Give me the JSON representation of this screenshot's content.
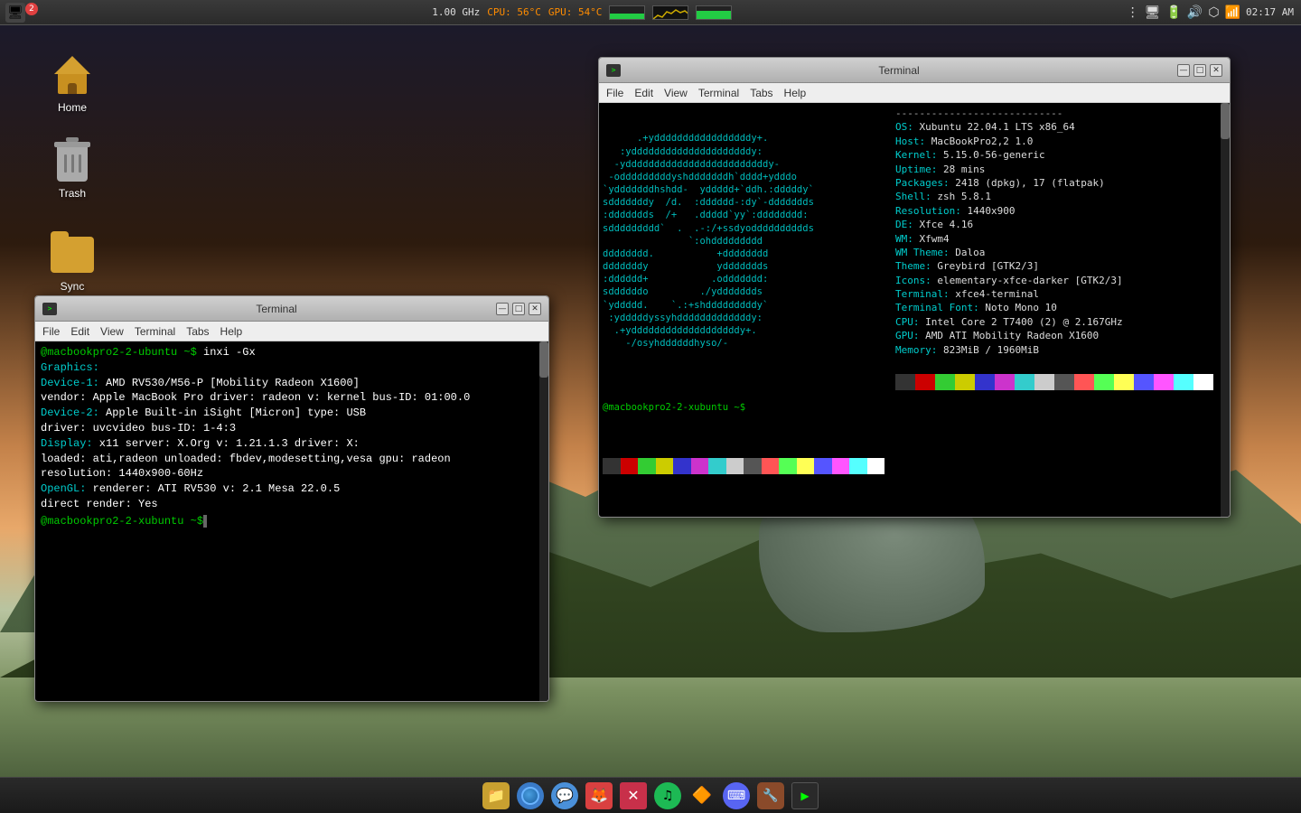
{
  "desktop": {
    "icons": [
      {
        "id": "home",
        "label": "Home",
        "type": "home"
      },
      {
        "id": "trash",
        "label": "Trash",
        "type": "trash"
      },
      {
        "id": "sync",
        "label": "Sync",
        "type": "folder"
      }
    ]
  },
  "top_panel": {
    "app_badge": "2",
    "cpu_label": "1.00 GHz",
    "cpu_temp": "CPU: 56°C",
    "gpu_temp": "GPU: 54°C",
    "time": "02:17 AM"
  },
  "terminal_big": {
    "title": "Terminal",
    "menu_items": [
      "File",
      "Edit",
      "View",
      "Terminal",
      "Tabs",
      "Help"
    ],
    "left_content": [
      "      .+ydddddddddddddddddy+.",
      "   :ydddddddddddddddddddddy:",
      "  -ydddddddddddddddddddddddddy-",
      " -odddddddddyshdddddddh`dddd+ydddo",
      "`ydddddddhshdd-  yddddd+`ddh.:dddddy`",
      "sdddddddy  /d.  :dddddd-:dy`-ddddddds",
      ":ddddddds  /+   .ddddd`yy`:dddddddd:",
      "sddddddddd`  .  .-:/+ssdyodddddddddds",
      "                  `:ohddddddddd",
      "dddddddd.           +dddddddd",
      "dddddddy            yddddddds",
      ":dddddd+           .oddddddd:",
      "sddddddo         ./yddddddds",
      "`yddddd.    `.:+shdddddddddy`",
      " :ydddddyssyhdddddddddddddy:",
      "  .+ydddddddddddddddddddy+.",
      "    -/osyhddddddhyso/-"
    ],
    "right_content": {
      "os": "OS: Xubuntu 22.04.1 LTS x86_64",
      "host": "Host: MacBookPro2,2 1.0",
      "kernel": "Kernel: 5.15.0-56-generic",
      "uptime": "Uptime: 28 mins",
      "packages": "Packages: 2418 (dpkg), 17 (flatpak)",
      "shell": "Shell: zsh 5.8.1",
      "resolution": "Resolution: 1440x900",
      "de": "DE: Xfce 4.16",
      "wm": "WM: Xfwm4",
      "wm_theme": "WM Theme: Daloa",
      "theme": "Theme: Greybird [GTK2/3]",
      "icons": "Icons: elementary-xfce-darker [GTK2/3]",
      "terminal": "Terminal: xfce4-terminal",
      "terminal_font": "Terminal Font: Noto Mono 10",
      "cpu": "CPU: Intel Core 2 T7400 (2) @ 2.167GHz",
      "gpu": "GPU: AMD ATI Mobility Radeon X1600",
      "memory": "Memory: 823MiB / 1960MiB"
    },
    "prompt": "@macbookpro2-2-xubuntu ~$"
  },
  "terminal_small": {
    "title": "Terminal",
    "menu_items": [
      "File",
      "Edit",
      "View",
      "Terminal",
      "Tabs",
      "Help"
    ],
    "command": "@macbookpro2-2-ubuntu ~$ inxi -Gx",
    "content_lines": [
      {
        "text": "Graphics:",
        "color": "cyan"
      },
      {
        "text": "  Device-1: AMD RV530/M56-P [Mobility Radeon X1600]",
        "color": "white"
      },
      {
        "text": "    vendor: Apple MacBook Pro  driver: radeon  v: kernel  bus-ID: 01:00.0",
        "color": "white"
      },
      {
        "text": "  Device-2: Apple Built-in iSight [Micron]  type: USB",
        "color": "white"
      },
      {
        "text": "    driver: uvcvideo  bus-ID: 1-4:3",
        "color": "white"
      },
      {
        "text": "  Display: x11  server: X.Org  v: 1.21.1.3  driver: X:",
        "color": "white"
      },
      {
        "text": "    loaded: ati,radeon  unloaded: fbdev,modesetting,vesa  gpu: radeon",
        "color": "white"
      },
      {
        "text": "    resolution: 1440x900-60Hz",
        "color": "white"
      },
      {
        "text": "  OpenGL: renderer: ATI RV530  v: 2.1 Mesa 22.0.5",
        "color": "white"
      },
      {
        "text": "    direct render: Yes",
        "color": "white"
      },
      {
        "text": "    @macbookpro2-2-xubuntu ~$",
        "color": "green"
      }
    ],
    "prompt": "@macbookpro2-2-xubuntu ~$"
  },
  "taskbar": {
    "icons": [
      {
        "id": "files",
        "label": "Files"
      },
      {
        "id": "browser1",
        "label": "Browser"
      },
      {
        "id": "chat",
        "label": "Chat"
      },
      {
        "id": "fox",
        "label": "Firefox"
      },
      {
        "id": "cross",
        "label": "Cross"
      },
      {
        "id": "spotify",
        "label": "Spotify"
      },
      {
        "id": "vlc",
        "label": "VLC"
      },
      {
        "id": "discord",
        "label": "Discord"
      },
      {
        "id": "other",
        "label": "Other"
      },
      {
        "id": "terminal",
        "label": "Terminal"
      }
    ]
  },
  "colors": {
    "palette": [
      "#cc0000",
      "#cc6600",
      "#cccc00",
      "#00cc00",
      "#0000cc",
      "#cc00cc",
      "#00cccc",
      "#cccccc",
      "#888888",
      "#ff4444",
      "#ff9944",
      "#ffff44",
      "#44ff44",
      "#4444ff",
      "#ff44ff",
      "#ffffff"
    ]
  }
}
